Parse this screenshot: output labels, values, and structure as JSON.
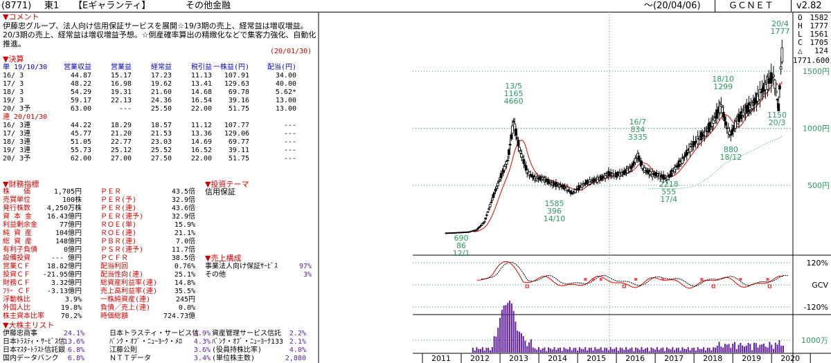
{
  "header": {
    "code": "(8771)",
    "market": "東1",
    "name": "【Eギャランティ】",
    "industry": "その他金融",
    "date": "〜(20/04/06)",
    "site": "ＧＣＮＥＴ",
    "version": "v2.82"
  },
  "comment": {
    "title": "▼コメント",
    "text": "伊藤忠グループ、法人向け信用保証サービスを展開☆19/3期の売上、経常益は増収増益。20/3期の売上、経常益は増収増益予想。☆倒産確率算出の精緻化などで集客力強化、自動化推進。",
    "date": "(20/01/30)"
  },
  "financials": {
    "title": "▼決算",
    "single_label": "単 19/10/30",
    "columns": [
      "営業収益",
      "営業益",
      "経常益",
      "税引益",
      "一株益(円)",
      "配当(円)"
    ],
    "single_rows": [
      [
        "16/ 3",
        "44.87",
        "15.17",
        "17.23",
        "11.13",
        "107.91",
        "34.00"
      ],
      [
        "17/ 3",
        "48.22",
        "16.98",
        "19.62",
        "13.41",
        "129.63",
        "40.00"
      ],
      [
        "18/ 3",
        "54.29",
        "19.31",
        "21.60",
        "14.68",
        "69.78",
        "5.62*"
      ],
      [
        "19/ 3",
        "59.17",
        "22.13",
        "24.36",
        "16.54",
        "39.16",
        "13.00"
      ],
      [
        "20/ 3予",
        "63.00",
        "---",
        "25.50",
        "22.00",
        "51.75",
        "13.00"
      ]
    ],
    "consol_label": "連 20/01/30",
    "consol_rows": [
      [
        "16/ 3連",
        "44.22",
        "18.29",
        "18.57",
        "11.12",
        "107.77",
        "---"
      ],
      [
        "17/ 3連",
        "45.77",
        "21.20",
        "21.53",
        "13.36",
        "129.06",
        "---"
      ],
      [
        "18/ 3連",
        "51.05",
        "22.77",
        "23.03",
        "14.69",
        "69.77",
        "---"
      ],
      [
        "19/ 3連",
        "55.73",
        "25.12",
        "25.52",
        "16.52",
        "39.11",
        "---"
      ],
      [
        "20/ 3予",
        "62.00",
        "27.00",
        "27.50",
        "22.00",
        "51.75",
        "---"
      ]
    ]
  },
  "indicators": {
    "title": "▼財務指標",
    "left": [
      [
        "株　　価",
        "1,705円"
      ],
      [
        "売買単位",
        "100株"
      ],
      [
        "発行株数",
        "4,250万株"
      ],
      [
        "資 本 金",
        "16.43億円"
      ],
      [
        "利益剰余金",
        "77億円"
      ],
      [
        "純 資 産",
        "104億円"
      ],
      [
        "総 資 産",
        "148億円"
      ],
      [
        "有利子負債",
        "0億円"
      ],
      [
        "設備投資",
        "--- 億円"
      ],
      [
        "営業ＣＦ",
        "18.82億円"
      ],
      [
        "投資ＣＦ",
        "-21.95億円"
      ],
      [
        "財務ＣＦ",
        "3.32億円"
      ],
      [
        "ﾌﾘｰ ＣＦ",
        "-3.13億円"
      ],
      [
        "浮動株比",
        "3.9%"
      ],
      [
        "外国人比",
        "19.8%"
      ],
      [
        "株主資本比率",
        "70.2%"
      ]
    ],
    "right": [
      [
        "ＰＥＲ",
        "43.5倍"
      ],
      [
        "ＰＥＲ(予)",
        "32.9倍"
      ],
      [
        "ＰＥＲ(連)",
        "43.6倍"
      ],
      [
        "ＰＥＲ(連予)",
        "32.9倍"
      ],
      [
        "ＲＯＥ(単)",
        "15.9%"
      ],
      [
        "ＲＯＥ(連)",
        "21.1%"
      ],
      [
        "ＰＢＲ(連)",
        "7.0倍"
      ],
      [
        "ＰＳＲ(連予)",
        "11.7倍"
      ],
      [
        "ＰＣＦＲ",
        "38.5倍"
      ],
      [
        "配当利回",
        "0.76%"
      ],
      [
        "配当性向(連)",
        "25.1%"
      ],
      [
        "総資産利益率(連)",
        "14.8%"
      ],
      [
        "売上高利益率(連)",
        "35.5%"
      ],
      [
        "一株純資産(連)",
        "245円"
      ],
      [
        "負債／売上(連)",
        "0.0%"
      ],
      [
        "時価総額",
        "724.73億"
      ]
    ]
  },
  "theme": {
    "title": "▼投資テーマ",
    "items": [
      "信用保証"
    ]
  },
  "composition": {
    "title": "▼売上構成",
    "items": [
      [
        "事業法人向け保証ｻｰﾋﾞｽ",
        "97%"
      ],
      [
        "その他",
        "3%"
      ]
    ]
  },
  "shareholders": {
    "title": "▼大株主リスト",
    "rows": [
      [
        [
          "伊藤忠商事",
          "24.1%"
        ],
        [
          "日本トラスティ・サービス信",
          "4.9%"
        ],
        [
          "資産管理サービス信託",
          "2.2%"
        ]
      ],
      [
        [
          "日本ﾄﾗｽﾃｨ・ｻｰﾋﾞｽ信",
          "13.6%"
        ],
        [
          "ﾊﾞﾝｸ・ｵﾌﾞ・ﾆｭｰﾖｰｸ・ﾒﾛ",
          "4.3%"
        ],
        [
          "ﾊﾞﾝｸ・ｵﾌﾞ・ﾆｭｰﾖｰｸ133",
          "2.1%"
        ]
      ],
      [
        [
          "日本ﾏｽﾀｰﾄﾗｽﾄ信託銀",
          "6.8%"
        ],
        [
          "江藤公則",
          "3.6%"
        ],
        [
          "(役員持株比率)",
          "4.0%"
        ]
      ],
      [
        [
          "国内データバンク",
          "6.8%"
        ],
        [
          "ＮＴＴデータ",
          "3.4%"
        ],
        [
          "(単位株主数)",
          "2,880"
        ]
      ]
    ]
  },
  "quote": {
    "O_label": "O",
    "O": "1582",
    "H_label": "H",
    "H": "1777",
    "L_label": "L",
    "L": "1561",
    "C_label": "C",
    "C": "1705",
    "D_label": "△",
    "D": "124",
    "last": "1771.600"
  },
  "chart_data": {
    "type": "candlestick",
    "x_ticks": [
      "2011",
      "2012",
      "2013",
      "2014",
      "2015",
      "2016",
      "2017",
      "2018",
      "2019",
      "2020"
    ],
    "price_axis_labels": [
      "1500円",
      "1000円",
      "500円"
    ],
    "price_ticks": [
      1500,
      1000,
      500
    ],
    "osc_axis_labels": [
      "120%",
      "GCV",
      "-120%"
    ],
    "volume_label": "1000万",
    "annotations": [
      {
        "date": "2012-01",
        "lines": [
          "690",
          "86",
          "12/1"
        ]
      },
      {
        "date": "2013-05",
        "lines": [
          "13/5",
          "1165",
          "4660"
        ]
      },
      {
        "date": "2014-10",
        "lines": [
          "1585",
          "396",
          "14/10"
        ]
      },
      {
        "date": "2016-07",
        "lines": [
          "16/7",
          "834",
          "3335"
        ]
      },
      {
        "date": "2017-04",
        "lines": [
          "2218",
          "555",
          "17/4"
        ]
      },
      {
        "date": "2018-10",
        "lines": [
          "18/10",
          "1299"
        ]
      },
      {
        "date": "2018-12",
        "lines": [
          "880",
          "18/12"
        ]
      },
      {
        "date": "2020-03",
        "lines": [
          "1150",
          "20/3"
        ]
      },
      {
        "date": "2020-04",
        "lines": [
          "20/4",
          "1777"
        ]
      }
    ],
    "price_series": [
      [
        2011.6,
        80
      ],
      [
        2011.8,
        82
      ],
      [
        2012.0,
        86
      ],
      [
        2012.2,
        90
      ],
      [
        2012.4,
        110
      ],
      [
        2012.6,
        180
      ],
      [
        2012.8,
        380
      ],
      [
        2013.0,
        560
      ],
      [
        2013.2,
        720
      ],
      [
        2013.35,
        1060
      ],
      [
        2013.5,
        820
      ],
      [
        2013.7,
        620
      ],
      [
        2013.9,
        560
      ],
      [
        2014.1,
        560
      ],
      [
        2014.3,
        520
      ],
      [
        2014.5,
        500
      ],
      [
        2014.7,
        480
      ],
      [
        2014.85,
        430
      ],
      [
        2015.0,
        470
      ],
      [
        2015.2,
        520
      ],
      [
        2015.4,
        540
      ],
      [
        2015.6,
        560
      ],
      [
        2015.8,
        600
      ],
      [
        2016.0,
        590
      ],
      [
        2016.2,
        610
      ],
      [
        2016.4,
        660
      ],
      [
        2016.55,
        760
      ],
      [
        2016.7,
        640
      ],
      [
        2016.9,
        600
      ],
      [
        2017.1,
        590
      ],
      [
        2017.3,
        555
      ],
      [
        2017.5,
        640
      ],
      [
        2017.7,
        720
      ],
      [
        2017.9,
        830
      ],
      [
        2018.1,
        900
      ],
      [
        2018.3,
        960
      ],
      [
        2018.5,
        1060
      ],
      [
        2018.7,
        1200
      ],
      [
        2018.85,
        1000
      ],
      [
        2018.95,
        940
      ],
      [
        2019.1,
        1060
      ],
      [
        2019.3,
        1150
      ],
      [
        2019.5,
        1200
      ],
      [
        2019.7,
        1300
      ],
      [
        2019.9,
        1400
      ],
      [
        2020.05,
        1460
      ],
      [
        2020.18,
        1180
      ],
      [
        2020.27,
        1705
      ]
    ]
  }
}
